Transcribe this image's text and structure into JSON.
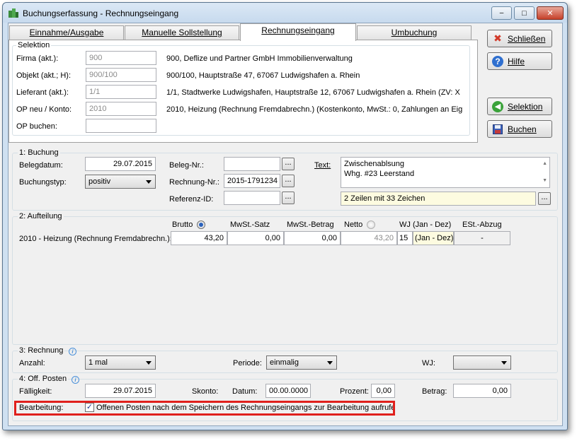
{
  "window": {
    "title": "Buchungserfassung - Rechnungseingang",
    "controls": {
      "minimize": "–",
      "maximize": "□",
      "close": "✕"
    }
  },
  "tabs": [
    {
      "label": "Einnahme/Ausgabe",
      "active": false
    },
    {
      "label": "Manuelle Sollstellung",
      "active": false
    },
    {
      "label": "Rechnungseingang",
      "active": true
    },
    {
      "label": "Umbuchung",
      "active": false
    }
  ],
  "selektion": {
    "legend": "Selektion",
    "rows": [
      {
        "label": "Firma (akt.):",
        "value": "900",
        "desc": "900,  Deflize und Partner GmbH Immobilienverwaltung"
      },
      {
        "label": "Objekt (akt.; H):",
        "value": "900/100",
        "desc": "900/100,  Hauptstraße 47, 67067 Ludwigshafen a. Rhein"
      },
      {
        "label": "Lieferant (akt.):",
        "value": "1/1",
        "desc": "1/1,  Stadtwerke Ludwigshafen,  Hauptstraße 12, 67067 Ludwigshafen a. Rhein  (ZV: X"
      },
      {
        "label": "OP neu / Konto:",
        "value": "2010",
        "desc": "2010,  Heizung (Rechnung Fremdabrechn.)  (Kostenkonto,  MwSt.: 0,  Zahlungen an Eig"
      },
      {
        "label": "OP buchen:",
        "value": "",
        "desc": ""
      }
    ]
  },
  "sidebuttons": {
    "close": "Schließen",
    "help": "Hilfe",
    "selection": "Selektion",
    "book": "Buchen"
  },
  "buchung": {
    "legend": "1: Buchung",
    "belegdatum_label": "Belegdatum:",
    "belegdatum": "29.07.2015",
    "buchungstyp_label": "Buchungstyp:",
    "buchungstyp": "positiv",
    "belegnr_label": "Beleg-Nr.:",
    "belegnr": "",
    "rechnungnr_label": "Rechnung-Nr.:",
    "rechnungnr": "2015-1791234",
    "referenz_label": "Referenz-ID:",
    "referenz": "",
    "text_label": "Text:",
    "text_line1": "Zwischenablsung",
    "text_line2": "Whg. #23 Leerstand",
    "text_info": "2 Zeilen mit 33 Zeichen",
    "dots": "..."
  },
  "aufteilung": {
    "legend": "2: Aufteilung",
    "headers": {
      "brutto": "Brutto",
      "mwst_satz": "MwSt.-Satz",
      "mwst_betrag": "MwSt.-Betrag",
      "netto": "Netto",
      "wj": "WJ  (Jan - Dez)",
      "est": "ESt.-Abzug"
    },
    "row": {
      "label": "2010 - Heizung (Rechnung Fremdabrechn.):",
      "brutto": "43,20",
      "mwst_satz": "0,00",
      "mwst_betrag": "0,00",
      "netto": "43,20",
      "wj_num": "15",
      "wj_range": "(Jan - Dez)",
      "est": "-"
    }
  },
  "rechnung": {
    "legend": "3: Rechnung",
    "anzahl_label": "Anzahl:",
    "anzahl": "1 mal",
    "periode_label": "Periode:",
    "periode": "einmalig",
    "wj_label": "WJ:",
    "wj": ""
  },
  "offposten": {
    "legend": "4: Off. Posten",
    "faelligkeit_label": "Fälligkeit:",
    "faelligkeit": "29.07.2015",
    "skonto_label": "Skonto:",
    "datum_label": "Datum:",
    "datum": "00.00.0000",
    "prozent_label": "Prozent:",
    "prozent": "0,00",
    "betrag_label": "Betrag:",
    "betrag": "0,00",
    "bearbeitung_label": "Bearbeitung:",
    "bearbeitung_text": "Offenen Posten nach dem Speichern des Rechnungseingangs zur Bearbeitung aufrufen",
    "bearbeitung_checked": true
  },
  "colors": {
    "highlight_border": "#e0201c",
    "window_frame": "#cfe0f1",
    "radio_dot": "#2a62bc"
  }
}
